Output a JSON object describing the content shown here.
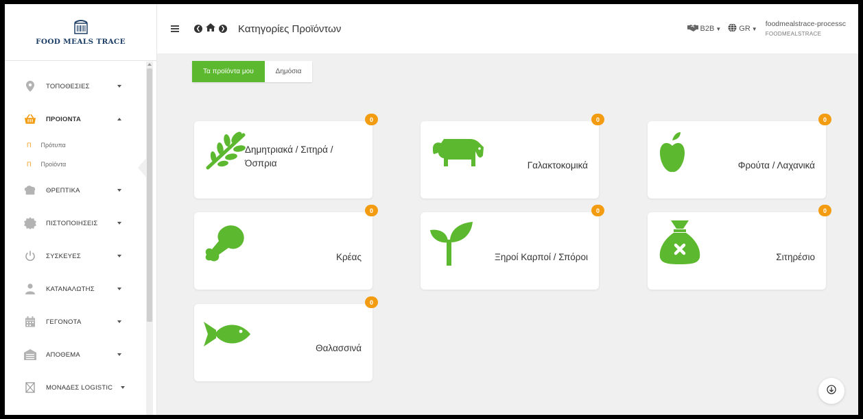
{
  "brand": {
    "name": "FOOD MEALS TRACE"
  },
  "header": {
    "page_title": "Κατηγορίες Προϊόντων",
    "b2b_label": "B2B",
    "lang_label": "GR",
    "user_name": "foodmealstrace-processc",
    "user_org": "FOODMEALSTRACE"
  },
  "sidebar": {
    "items": [
      {
        "label": "ΤΟΠΟΘΕΣΙΕΣ",
        "icon": "location-pin-icon"
      },
      {
        "label": "ΠΡΟΙΟΝΤΑ",
        "icon": "basket-icon",
        "expanded": true
      },
      {
        "label": "ΘΡΕΠΤΙΚΑ",
        "icon": "chef-hat-icon"
      },
      {
        "label": "ΠΙΣΤΟΠΟΙΗΣΕΙΣ",
        "icon": "certificate-icon"
      },
      {
        "label": "ΣΥΣΚΕΥΕΣ",
        "icon": "power-icon"
      },
      {
        "label": "ΚΑΤΑΝΑΛΩΤΗΣ",
        "icon": "user-icon"
      },
      {
        "label": "ΓΕΓΟΝΟΤΑ",
        "icon": "calendar-icon"
      },
      {
        "label": "ΑΠΟΘΕΜΑ",
        "icon": "warehouse-icon"
      },
      {
        "label": "ΜΟΝΑΔΕΣ LOGISTIC",
        "icon": "box-icon"
      }
    ],
    "subitems": [
      {
        "label": "Πρότυπα",
        "bullet": "Π"
      },
      {
        "label": "Προϊόντα",
        "bullet": "Π"
      }
    ]
  },
  "tabs": [
    {
      "label": "Τα προϊόντα μου",
      "active": true
    },
    {
      "label": "Δημόσια",
      "active": false
    }
  ],
  "categories": [
    {
      "label_line1": "Δημητριακά / Σιτηρά /",
      "label_line2": "Όσπρια",
      "count": "0",
      "icon": "wheat-icon"
    },
    {
      "label": "Γαλακτοκομικά",
      "count": "0",
      "icon": "cow-icon"
    },
    {
      "label": "Φρούτα / Λαχανικά",
      "count": "0",
      "icon": "apple-icon"
    },
    {
      "label": "Κρέας",
      "count": "0",
      "icon": "drumstick-icon"
    },
    {
      "label": "Ξηροί Καρποί / Σπόροι",
      "count": "0",
      "icon": "seedling-icon"
    },
    {
      "label": "Σιτηρέσιο",
      "count": "0",
      "icon": "sack-icon"
    },
    {
      "label": "Θαλασσινά",
      "count": "0",
      "icon": "fish-icon"
    }
  ],
  "colors": {
    "accent": "#5cb82e",
    "badge": "#f39c12",
    "sidebar_brand": "#1e3f66"
  }
}
